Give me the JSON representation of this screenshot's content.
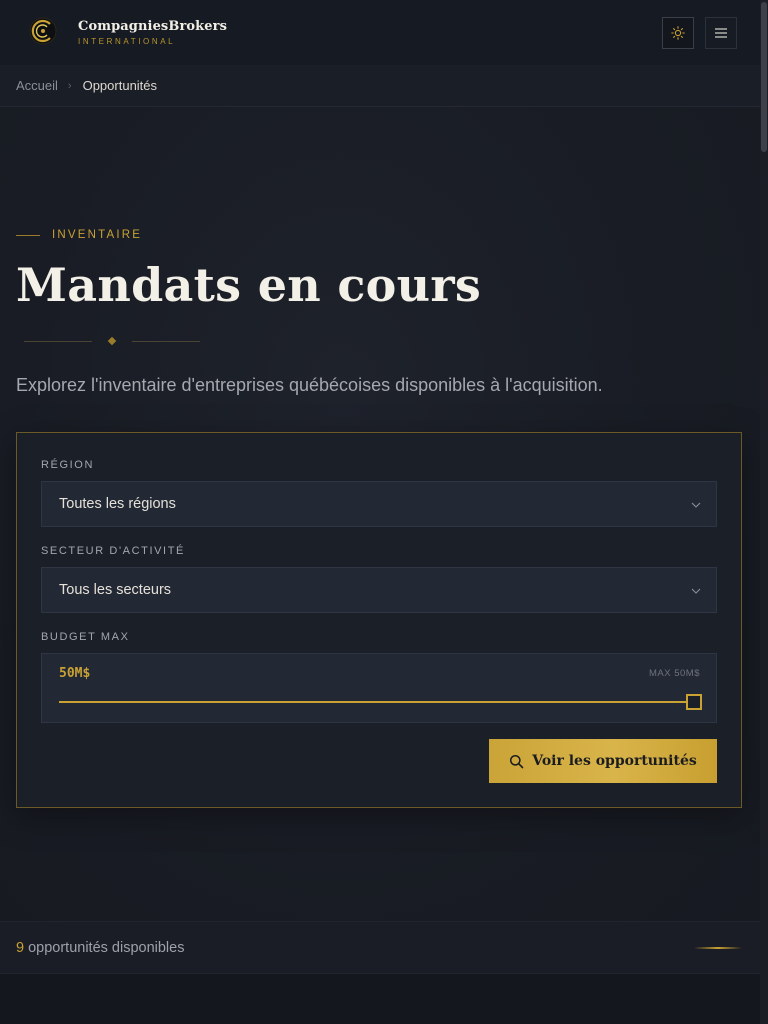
{
  "brand": {
    "name": "CompagniesBrokers",
    "tagline": "INTERNATIONAL"
  },
  "header": {
    "theme_icon": "sun-icon",
    "menu_icon": "hamburger-menu-icon"
  },
  "breadcrumb": {
    "home": "Accueil",
    "separator_icon": "chevron-right-icon",
    "current": "Opportunités"
  },
  "hero": {
    "eyebrow": "INVENTAIRE",
    "title": "Mandats en cours",
    "subtitle": "Explorez l'inventaire d'entreprises québécoises disponibles à l'acquisition."
  },
  "filters": {
    "region": {
      "label": "RÉGION",
      "selected": "Toutes les régions"
    },
    "sector": {
      "label": "SECTEUR D'ACTIVITÉ",
      "selected": "Tous les secteurs"
    },
    "budget": {
      "label": "BUDGET MAX",
      "value_text": "50M$",
      "max_text": "MAX 50M$",
      "value_fraction": 1.0
    },
    "submit_label": "Voir les opportunités",
    "submit_icon": "search-icon"
  },
  "results": {
    "count": "9",
    "label": "opportunités disponibles"
  },
  "colors": {
    "accent": "#c9a233",
    "background": "#15181f",
    "panel": "#1b1f28",
    "field": "#232835"
  }
}
